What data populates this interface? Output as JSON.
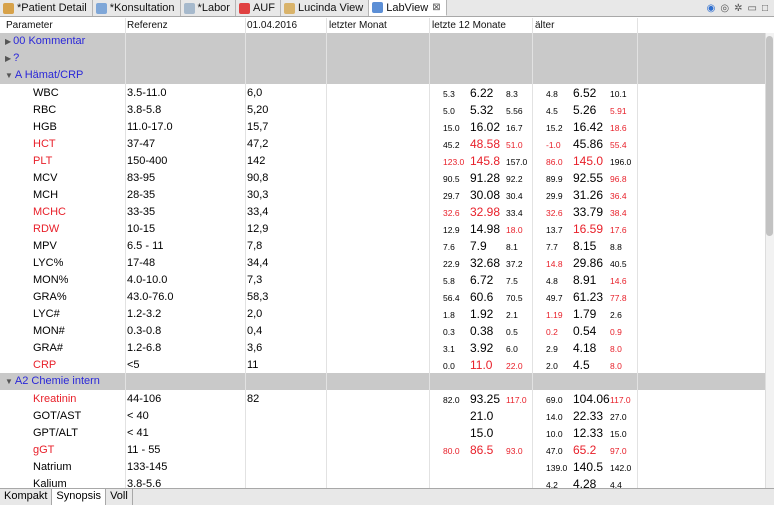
{
  "tabs": [
    {
      "label": "*Patient Detail",
      "icon": "patient-icon",
      "color": "#d7a24a"
    },
    {
      "label": "*Konsultation",
      "icon": "consultation-icon",
      "color": "#7fa7d8"
    },
    {
      "label": "*Labor",
      "icon": "lab-icon",
      "color": "#a6b9cc"
    },
    {
      "label": "AUF",
      "icon": "warning-icon",
      "color": "#e04040"
    },
    {
      "label": "Lucinda View",
      "icon": "lucinda-icon",
      "color": "#d9b36a"
    },
    {
      "label": "LabView",
      "icon": "labview-icon",
      "color": "#5c8fd6",
      "close": "⊠"
    }
  ],
  "toolbar_icons": [
    "globe-icon",
    "eye-icon",
    "settings-icon",
    "minimize-icon",
    "maximize-icon"
  ],
  "columns": [
    "Parameter",
    "Referenz",
    "01.04.2016",
    "letzter Monat",
    "letzte 12 Monate",
    "älter"
  ],
  "rows": [
    {
      "type": "group",
      "label": "00 Kommentar",
      "arrow": "▶"
    },
    {
      "type": "group",
      "label": "?",
      "arrow": "▶"
    },
    {
      "type": "group",
      "label": "A Hämat/CRP",
      "arrow": "▼"
    },
    {
      "name": "WBC",
      "ref": "3.5-11.0",
      "d1": "6,0",
      "l12": [
        "5.3",
        "6.22",
        "8.3"
      ],
      "old": [
        "4.8",
        "6.52",
        "10.1"
      ]
    },
    {
      "name": "RBC",
      "ref": "3.8-5.8",
      "d1": "5,20",
      "l12": [
        "5.0",
        "5.32",
        "5.56"
      ],
      "old": [
        "4.5",
        "5.26",
        "5.91"
      ],
      "oldRed": [
        false,
        false,
        true
      ]
    },
    {
      "name": "HGB",
      "ref": "11.0-17.0",
      "d1": "15,7",
      "l12": [
        "15.0",
        "16.02",
        "16.7"
      ],
      "old": [
        "15.2",
        "16.42",
        "18.6"
      ],
      "oldRed": [
        false,
        false,
        true
      ]
    },
    {
      "name": "HCT",
      "red": true,
      "ref": "37-47",
      "d1": "47,2",
      "l12": [
        "45.2",
        "48.58",
        "51.0"
      ],
      "l12Red": [
        false,
        true,
        true
      ],
      "old": [
        "-1.0",
        "45.86",
        "55.4"
      ],
      "oldRed": [
        true,
        false,
        true
      ]
    },
    {
      "name": "PLT",
      "red": true,
      "ref": "150-400",
      "d1": "142",
      "l12": [
        "123.0",
        "145.8",
        "157.0"
      ],
      "l12Red": [
        true,
        true,
        false
      ],
      "old": [
        "86.0",
        "145.0",
        "196.0"
      ],
      "oldRed": [
        true,
        true,
        false
      ]
    },
    {
      "name": "MCV",
      "ref": "83-95",
      "d1": "90,8",
      "l12": [
        "90.5",
        "91.28",
        "92.2"
      ],
      "old": [
        "89.9",
        "92.55",
        "96.8"
      ],
      "oldRed": [
        false,
        false,
        true
      ]
    },
    {
      "name": "MCH",
      "ref": "28-35",
      "d1": "30,3",
      "l12": [
        "29.7",
        "30.08",
        "30.4"
      ],
      "old": [
        "29.9",
        "31.26",
        "36.4"
      ],
      "oldRed": [
        false,
        false,
        true
      ]
    },
    {
      "name": "MCHC",
      "red": true,
      "ref": "33-35",
      "d1": "33,4",
      "l12": [
        "32.6",
        "32.98",
        "33.4"
      ],
      "l12Red": [
        true,
        true,
        false
      ],
      "old": [
        "32.6",
        "33.79",
        "38.4"
      ],
      "oldRed": [
        true,
        false,
        true
      ]
    },
    {
      "name": "RDW",
      "red": true,
      "ref": "10-15",
      "d1": "12,9",
      "l12": [
        "12.9",
        "14.98",
        "18.0"
      ],
      "l12Red": [
        false,
        false,
        true
      ],
      "old": [
        "13.7",
        "16.59",
        "17.6"
      ],
      "oldRed": [
        false,
        true,
        true
      ]
    },
    {
      "name": "MPV",
      "ref": "6.5 - 11",
      "d1": "7,8",
      "l12": [
        "7.6",
        "7.9",
        "8.1"
      ],
      "old": [
        "7.7",
        "8.15",
        "8.8"
      ]
    },
    {
      "name": "LYC%",
      "ref": "17-48",
      "d1": "34,4",
      "l12": [
        "22.9",
        "32.68",
        "37.2"
      ],
      "old": [
        "14.8",
        "29.86",
        "40.5"
      ],
      "oldRed": [
        true,
        false,
        false
      ]
    },
    {
      "name": "MON%",
      "ref": "4.0-10.0",
      "d1": "7,3",
      "l12": [
        "5.8",
        "6.72",
        "7.5"
      ],
      "old": [
        "4.8",
        "8.91",
        "14.6"
      ],
      "oldRed": [
        false,
        false,
        true
      ]
    },
    {
      "name": "GRA%",
      "ref": "43.0-76.0",
      "d1": "58,3",
      "l12": [
        "56.4",
        "60.6",
        "70.5"
      ],
      "old": [
        "49.7",
        "61.23",
        "77.8"
      ],
      "oldRed": [
        false,
        false,
        true
      ]
    },
    {
      "name": "LYC#",
      "ref": "1.2-3.2",
      "d1": "2,0",
      "l12": [
        "1.8",
        "1.92",
        "2.1"
      ],
      "old": [
        "1.19",
        "1.79",
        "2.6"
      ],
      "oldRed": [
        true,
        false,
        false
      ]
    },
    {
      "name": "MON#",
      "ref": "0.3-0.8",
      "d1": "0,4",
      "l12": [
        "0.3",
        "0.38",
        "0.5"
      ],
      "old": [
        "0.2",
        "0.54",
        "0.9"
      ],
      "oldRed": [
        true,
        false,
        true
      ]
    },
    {
      "name": "GRA#",
      "ref": "1.2-6.8",
      "d1": "3,6",
      "l12": [
        "3.1",
        "3.92",
        "6.0"
      ],
      "old": [
        "2.9",
        "4.18",
        "8.0"
      ],
      "oldRed": [
        false,
        false,
        true
      ]
    },
    {
      "name": "CRP",
      "red": true,
      "ref": "<5",
      "d1": "11",
      "l12": [
        "0.0",
        "11.0",
        "22.0"
      ],
      "l12Red": [
        false,
        true,
        true
      ],
      "old": [
        "2.0",
        "4.5",
        "8.0"
      ],
      "oldRed": [
        false,
        false,
        true
      ]
    },
    {
      "type": "group",
      "label": "A2 Chemie intern",
      "arrow": "▼"
    },
    {
      "name": "Kreatinin",
      "red": true,
      "ref": "44-106",
      "d1": "82",
      "l12": [
        "82.0",
        "93.25",
        "117.0"
      ],
      "l12Red": [
        false,
        false,
        true
      ],
      "old": [
        "69.0",
        "104.06",
        "117.0"
      ],
      "oldRed": [
        false,
        false,
        true
      ]
    },
    {
      "name": "GOT/AST",
      "ref": "< 40",
      "d1": "",
      "l12": [
        "",
        "21.0",
        ""
      ],
      "old": [
        "14.0",
        "22.33",
        "27.0"
      ]
    },
    {
      "name": "GPT/ALT",
      "ref": "< 41",
      "d1": "",
      "l12": [
        "",
        "15.0",
        ""
      ],
      "old": [
        "10.0",
        "12.33",
        "15.0"
      ]
    },
    {
      "name": "gGT",
      "red": true,
      "ref": "11 - 55",
      "d1": "",
      "l12": [
        "80.0",
        "86.5",
        "93.0"
      ],
      "l12Red": [
        true,
        true,
        true
      ],
      "old": [
        "47.0",
        "65.2",
        "97.0"
      ],
      "oldRed": [
        false,
        true,
        true
      ]
    },
    {
      "name": "Natrium",
      "ref": "133-145",
      "d1": "",
      "l12": [
        "",
        "",
        ""
      ],
      "old": [
        "139.0",
        "140.5",
        "142.0"
      ]
    },
    {
      "name": "Kalium",
      "ref": "3.8-5.6",
      "d1": "",
      "l12": [
        "",
        "",
        ""
      ],
      "old": [
        "4.2",
        "4.28",
        "4.4"
      ]
    }
  ],
  "bottom_tabs": [
    "Kompakt",
    "Synopsis",
    "Voll"
  ],
  "active_bottom_tab": 1
}
